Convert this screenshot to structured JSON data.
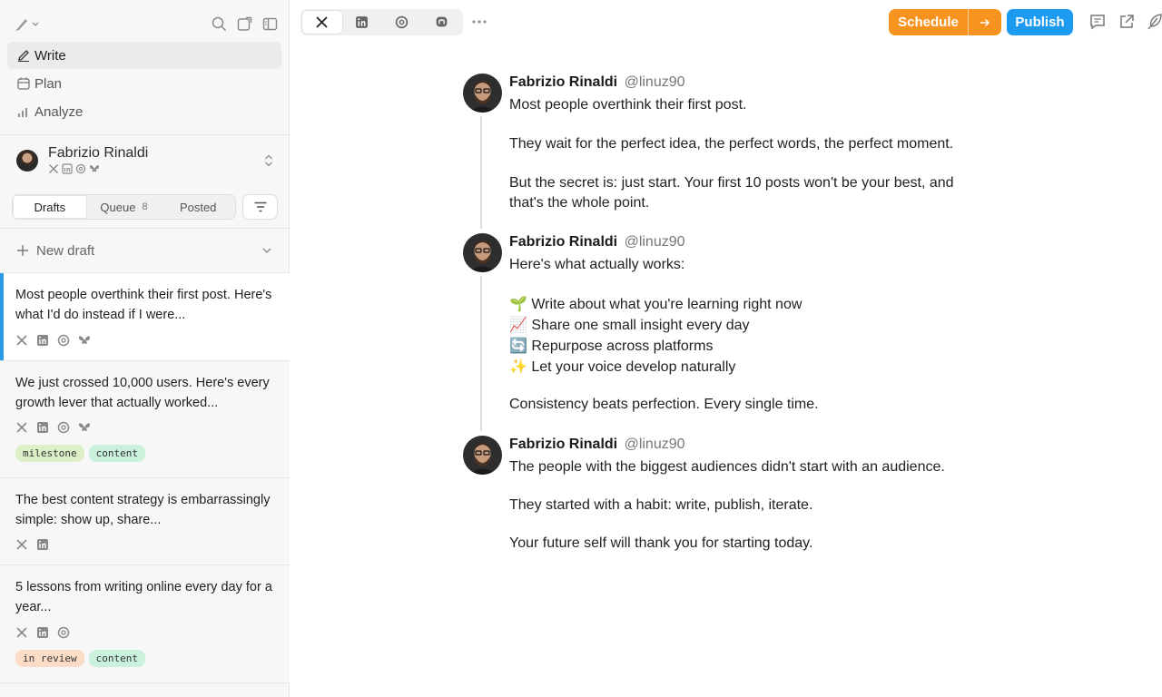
{
  "sidebar": {
    "nav": [
      {
        "label": "Write",
        "icon": "pen-icon",
        "active": true
      },
      {
        "label": "Plan",
        "icon": "calendar-icon",
        "active": false
      },
      {
        "label": "Analyze",
        "icon": "bar-chart-icon",
        "active": false
      }
    ],
    "account": {
      "name": "Fabrizio Rinaldi",
      "networks": [
        "x-icon",
        "linkedin-icon",
        "threads-icon",
        "bluesky-icon"
      ]
    },
    "tabs": [
      {
        "label": "Drafts",
        "active": true
      },
      {
        "label": "Queue",
        "count": "8"
      },
      {
        "label": "Posted"
      }
    ],
    "new_draft_label": "New draft",
    "drafts": [
      {
        "text": "Most people overthink their first post. Here's what I'd do instead if I were...",
        "networks": [
          "x",
          "linkedin",
          "threads",
          "bluesky"
        ],
        "tags": []
      },
      {
        "text": "We just crossed 10,000 users. Here's every growth lever that actually worked...",
        "networks": [
          "x",
          "linkedin",
          "threads",
          "bluesky"
        ],
        "tags": [
          "milestone",
          "content"
        ]
      },
      {
        "text": "The best content strategy is embarrassingly simple: show up, share...",
        "networks": [
          "x",
          "linkedin"
        ],
        "tags": []
      },
      {
        "text": "5 lessons from writing online every day for a year...",
        "networks": [
          "x",
          "linkedin",
          "threads"
        ],
        "tags": [
          "in review",
          "content"
        ]
      }
    ]
  },
  "toolbar": {
    "network_tabs": [
      "x-icon",
      "linkedin-icon",
      "threads-icon",
      "mastodon-icon"
    ],
    "schedule_label": "Schedule",
    "publish_label": "Publish"
  },
  "colors": {
    "schedule": "#f7931e",
    "publish": "#1d9bf0",
    "selected_bar": "#2b9be8",
    "tag_milestone": "#dcefc7",
    "tag_content": "#c9f1dc",
    "tag_review": "#fbdcc7"
  },
  "thread": [
    {
      "name": "Fabrizio Rinaldi",
      "handle": "@linuz90",
      "lines": [
        "Most people overthink their first post.",
        "They wait for the perfect idea, the perfect words, the perfect moment.",
        "But the secret is: just start. Your first 10 posts won't be your best, and",
        "that's the whole point."
      ]
    },
    {
      "name": "Fabrizio Rinaldi",
      "handle": "@linuz90",
      "lines": [
        "Here's what actually works:",
        "🌱 Write about what you're learning right now",
        "📈 Share one small insight every day",
        "🔄 Repurpose across platforms",
        "✨ Let your voice develop naturally",
        "Consistency beats perfection. Every single time."
      ]
    },
    {
      "name": "Fabrizio Rinaldi",
      "handle": "@linuz90",
      "lines": [
        "The people with the biggest audiences didn't start with an audience.",
        "They started with a habit: write, publish, iterate.",
        "Your future self will thank you for starting today."
      ]
    }
  ]
}
